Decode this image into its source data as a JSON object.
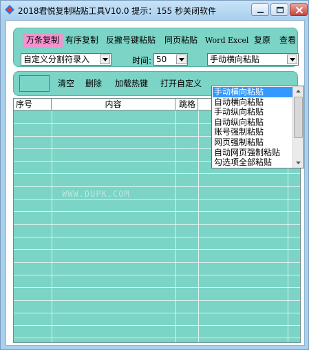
{
  "window": {
    "title": "2018君悦复制粘贴工具V10.0 提示：155 秒关闭软件"
  },
  "toolbar_top": {
    "menu": [
      {
        "label": "万条复制",
        "active": true
      },
      {
        "label": "有序复制",
        "active": false
      },
      {
        "label": "反撇号键粘贴",
        "active": false
      },
      {
        "label": "同页粘贴",
        "active": false
      },
      {
        "label": "Word",
        "active": false
      },
      {
        "label": "Excel",
        "active": false
      },
      {
        "label": "复原",
        "active": false
      },
      {
        "label": "查看",
        "active": false
      }
    ],
    "mode_select": {
      "value": "自定义分割符录入"
    },
    "time_label": "时间:",
    "time_select": {
      "value": "50"
    },
    "paste_select": {
      "value": "手动横向粘贴"
    }
  },
  "toolbar_mid": {
    "buttons": [
      "清空",
      "删除",
      "加载热键",
      "打开自定义"
    ]
  },
  "table": {
    "columns": [
      "序号",
      "内容",
      "跳格",
      "",
      ""
    ]
  },
  "watermark": "WWW.DUPK.COM",
  "dropdown": {
    "options": [
      "手动横向粘贴",
      "自动横向粘贴",
      "手动纵向粘贴",
      "自动纵向粘贴",
      "账号强制粘贴",
      "网页强制粘贴",
      "自动网页强制粘贴",
      "勾选项全部粘贴"
    ],
    "selected_index": 0
  },
  "colors": {
    "accent_panel": "#7bd4c6",
    "active_tab": "#f592d0",
    "selection": "#3399ff"
  }
}
